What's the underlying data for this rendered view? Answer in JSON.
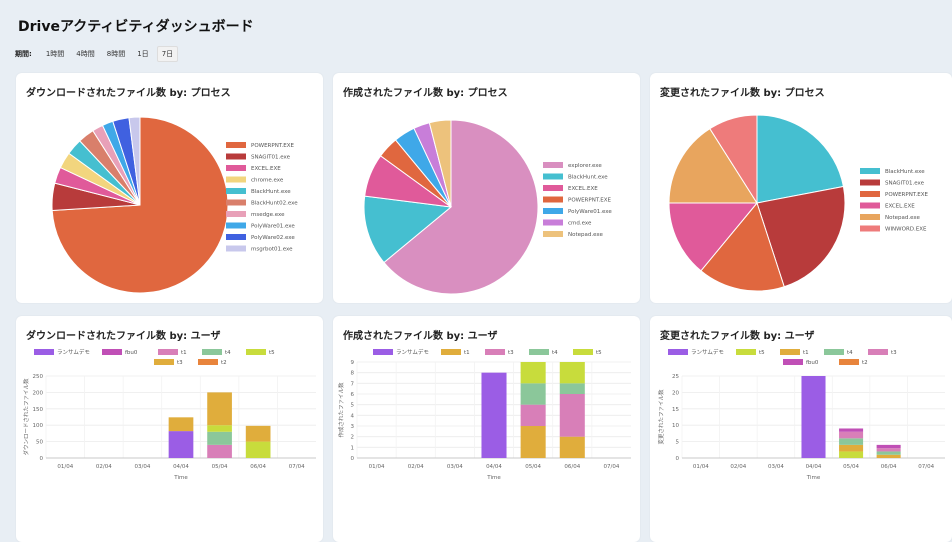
{
  "header": {
    "title": "Driveアクティビティダッシュボード",
    "period_label": "期間:",
    "periods": [
      "1時間",
      "4時間",
      "8時間",
      "1日",
      "7日"
    ],
    "active_period": "7日"
  },
  "colors": {
    "background": "#e8eef4",
    "card": "#ffffff"
  },
  "cards": [
    {
      "title": "ダウンロードされたファイル数 by: プロセス",
      "chart_data": {
        "type": "pie",
        "labels": [
          "POWERPNT.EXE",
          "SNAGIT01.exe",
          "EXCEL.EXE",
          "chrome.exe",
          "BlackHunt.exe",
          "BlackHunt02.exe",
          "msedge.exe",
          "PolyWare01.exe",
          "PolyWare02.exe",
          "msgrbot01.exe"
        ],
        "values": [
          74,
          5,
          3,
          3,
          3,
          3,
          2,
          2,
          3,
          2
        ],
        "colors": [
          "#e0673f",
          "#b83b3b",
          "#e05a9a",
          "#f2d57e",
          "#45bfd0",
          "#d97f6b",
          "#e8a0b8",
          "#3fa8e8",
          "#4061e0",
          "#c8c8ec"
        ],
        "legend_position": "right"
      }
    },
    {
      "title": "作成されたファイル数 by: プロセス",
      "chart_data": {
        "type": "pie",
        "labels": [
          "explorer.exe",
          "BlackHunt.exe",
          "EXCEL.EXE",
          "POWERPNT.EXE",
          "PolyWare01.exe",
          "cmd.exe",
          "Notepad.exe"
        ],
        "values": [
          64,
          13,
          8,
          4,
          4,
          3,
          4
        ],
        "colors": [
          "#d98fc0",
          "#45bfd0",
          "#e05a9a",
          "#e0673f",
          "#3fa8e8",
          "#c87ed9",
          "#edc27c"
        ],
        "legend_position": "right"
      }
    },
    {
      "title": "変更されたファイル数 by: プロセス",
      "chart_data": {
        "type": "pie",
        "labels": [
          "BlackHunt.exe",
          "SNAGIT01.exe",
          "POWERPNT.EXE",
          "EXCEL.EXE",
          "Notepad.exe",
          "WINWORD.EXE"
        ],
        "values": [
          22,
          23,
          16,
          14,
          16,
          9
        ],
        "colors": [
          "#45bfd0",
          "#b83b3b",
          "#e0673f",
          "#e05a9a",
          "#e8a55e",
          "#ee7b7b"
        ],
        "legend_position": "right"
      }
    },
    {
      "title": "ダウンロードされたファイル数 by: ユーザ",
      "chart_data": {
        "type": "bar",
        "stacked": true,
        "categories": [
          "01/04",
          "02/04",
          "03/04",
          "04/04",
          "05/04",
          "06/04",
          "07/04"
        ],
        "series": [
          {
            "name": "ランサムデモ",
            "color": "#9b5de5",
            "values": [
              0,
              0,
              0,
              82,
              0,
              0,
              0
            ]
          },
          {
            "name": "fbu0",
            "color": "#c04fb6",
            "values": [
              0,
              0,
              0,
              0,
              0,
              0,
              0
            ]
          },
          {
            "name": "t1",
            "color": "#d87fb8",
            "values": [
              0,
              0,
              0,
              0,
              40,
              0,
              0
            ]
          },
          {
            "name": "t4",
            "color": "#8bc79a",
            "values": [
              0,
              0,
              0,
              0,
              40,
              0,
              0
            ]
          },
          {
            "name": "t5",
            "color": "#c8dc3c",
            "values": [
              0,
              0,
              0,
              0,
              20,
              50,
              0
            ]
          },
          {
            "name": "t3",
            "color": "#e0ad3c",
            "values": [
              0,
              0,
              0,
              42,
              100,
              48,
              0
            ]
          },
          {
            "name": "t2",
            "color": "#e8843c",
            "values": [
              0,
              0,
              0,
              0,
              0,
              0,
              0
            ]
          }
        ],
        "xlabel": "Time",
        "ylabel": "ダウンロードされたファイル数",
        "ylim": [
          0,
          250
        ],
        "yticks": [
          0,
          50,
          100,
          150,
          200,
          250
        ],
        "grid": true,
        "legend_position": "top"
      }
    },
    {
      "title": "作成されたファイル数 by: ユーザ",
      "chart_data": {
        "type": "bar",
        "stacked": true,
        "categories": [
          "01/04",
          "02/04",
          "03/04",
          "04/04",
          "05/04",
          "06/04",
          "07/04"
        ],
        "series": [
          {
            "name": "ランサムデモ",
            "color": "#9b5de5",
            "values": [
              0,
              0,
              0,
              8,
              0,
              0,
              0
            ]
          },
          {
            "name": "t1",
            "color": "#e0ad3c",
            "values": [
              0,
              0,
              0,
              0,
              3,
              2,
              0
            ]
          },
          {
            "name": "t3",
            "color": "#d87fb8",
            "values": [
              0,
              0,
              0,
              0,
              2,
              4,
              0
            ]
          },
          {
            "name": "t4",
            "color": "#8bc79a",
            "values": [
              0,
              0,
              0,
              0,
              2,
              1,
              0
            ]
          },
          {
            "name": "t5",
            "color": "#c8dc3c",
            "values": [
              0,
              0,
              0,
              0,
              2,
              2,
              0
            ]
          }
        ],
        "xlabel": "Time",
        "ylabel": "作成されたファイル数",
        "ylim": [
          0,
          9
        ],
        "yticks": [
          0,
          1,
          2,
          3,
          4,
          5,
          6,
          7,
          8,
          9
        ],
        "grid": true,
        "legend_position": "top"
      }
    },
    {
      "title": "変更されたファイル数 by: ユーザ",
      "chart_data": {
        "type": "bar",
        "stacked": true,
        "categories": [
          "01/04",
          "02/04",
          "03/04",
          "04/04",
          "05/04",
          "06/04",
          "07/04"
        ],
        "series": [
          {
            "name": "ランサムデモ",
            "color": "#9b5de5",
            "values": [
              0,
              0,
              0,
              25,
              0,
              0,
              0
            ]
          },
          {
            "name": "t5",
            "color": "#c8dc3c",
            "values": [
              0,
              0,
              0,
              0,
              2,
              0,
              0
            ]
          },
          {
            "name": "t1",
            "color": "#e0ad3c",
            "values": [
              0,
              0,
              0,
              0,
              2,
              1,
              0
            ]
          },
          {
            "name": "t4",
            "color": "#8bc79a",
            "values": [
              0,
              0,
              0,
              0,
              2,
              1,
              0
            ]
          },
          {
            "name": "t3",
            "color": "#d87fb8",
            "values": [
              0,
              0,
              0,
              0,
              2,
              1,
              0
            ]
          },
          {
            "name": "fbu0",
            "color": "#c04fb6",
            "values": [
              0,
              0,
              0,
              0,
              1,
              1,
              0
            ]
          },
          {
            "name": "t2",
            "color": "#e8843c",
            "values": [
              0,
              0,
              0,
              0,
              0,
              0,
              0
            ]
          }
        ],
        "xlabel": "Time",
        "ylabel": "変更されたファイル数",
        "ylim": [
          0,
          25
        ],
        "yticks": [
          0,
          5,
          10,
          15,
          20,
          25
        ],
        "grid": true,
        "legend_position": "top"
      }
    }
  ]
}
